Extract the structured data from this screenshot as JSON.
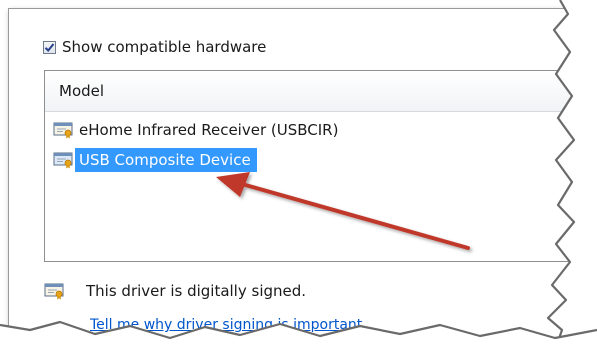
{
  "show_compatible": {
    "label": "Show compatible hardware",
    "checked": true
  },
  "model_list": {
    "header": "Model",
    "items": [
      {
        "label": "eHome Infrared Receiver (USBCIR)",
        "selected": false,
        "icon": "certificate-icon"
      },
      {
        "label": "USB Composite Device",
        "selected": true,
        "icon": "certificate-icon"
      }
    ]
  },
  "signature": {
    "text": "This driver is digitally signed.",
    "icon": "certificate-icon"
  },
  "help_link": {
    "text": "Tell me why driver signing is important"
  },
  "colors": {
    "selection": "#3399ff",
    "arrow": "#c0392b",
    "link": "#0055cc"
  }
}
